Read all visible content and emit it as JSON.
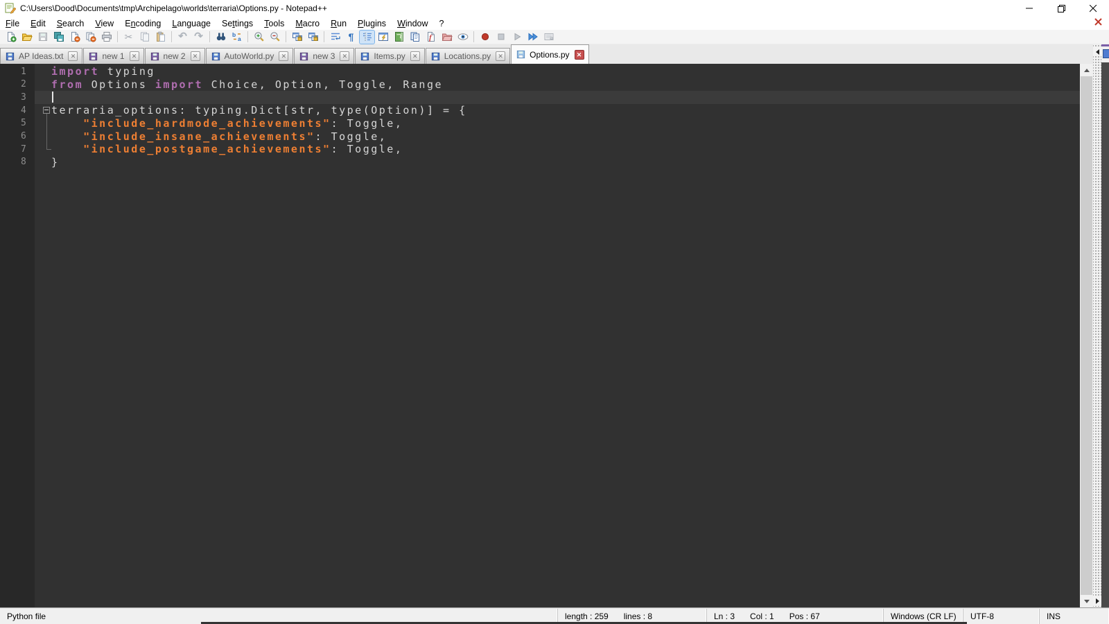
{
  "window": {
    "title": "C:\\Users\\Dood\\Documents\\tmp\\Archipelago\\worlds\\terraria\\Options.py - Notepad++"
  },
  "menu": {
    "items": [
      {
        "label": "File",
        "accel": 0
      },
      {
        "label": "Edit",
        "accel": 0
      },
      {
        "label": "Search",
        "accel": 0
      },
      {
        "label": "View",
        "accel": 0
      },
      {
        "label": "Encoding",
        "accel": 1
      },
      {
        "label": "Language",
        "accel": 0
      },
      {
        "label": "Settings",
        "accel": 2
      },
      {
        "label": "Tools",
        "accel": 0
      },
      {
        "label": "Macro",
        "accel": 0
      },
      {
        "label": "Run",
        "accel": 0
      },
      {
        "label": "Plugins",
        "accel": 0
      },
      {
        "label": "Window",
        "accel": 0
      },
      {
        "label": "?",
        "accel": -1
      }
    ]
  },
  "toolbar": {
    "buttons": [
      {
        "name": "new-file",
        "icon": "page-new"
      },
      {
        "name": "open-file",
        "icon": "folder-open"
      },
      {
        "name": "save-file",
        "icon": "floppy-gray",
        "disabled": true
      },
      {
        "name": "save-all",
        "icon": "floppy-all"
      },
      {
        "name": "close-file",
        "icon": "page-close"
      },
      {
        "name": "close-all",
        "icon": "pages-close"
      },
      {
        "name": "print",
        "icon": "printer"
      },
      {
        "sep": true
      },
      {
        "name": "cut",
        "icon": "scissors",
        "disabled": true
      },
      {
        "name": "copy",
        "icon": "copy",
        "disabled": true
      },
      {
        "name": "paste",
        "icon": "paste",
        "disabled": true
      },
      {
        "sep": true
      },
      {
        "name": "undo",
        "icon": "undo",
        "disabled": true
      },
      {
        "name": "redo",
        "icon": "redo",
        "disabled": true
      },
      {
        "sep": true
      },
      {
        "name": "find",
        "icon": "binoculars"
      },
      {
        "name": "replace",
        "icon": "replace"
      },
      {
        "sep": true
      },
      {
        "name": "zoom-in",
        "icon": "zoom-in"
      },
      {
        "name": "zoom-out",
        "icon": "zoom-out"
      },
      {
        "sep": true
      },
      {
        "name": "sync-vertical-scroll",
        "icon": "sync-v"
      },
      {
        "name": "sync-horizontal-scroll",
        "icon": "sync-h"
      },
      {
        "sep": true
      },
      {
        "name": "word-wrap",
        "icon": "wrap"
      },
      {
        "name": "show-all-characters",
        "icon": "pilcrow"
      },
      {
        "name": "show-indent-guide",
        "icon": "indent-guide",
        "pressed": true
      },
      {
        "name": "user-defined-language",
        "icon": "udl"
      },
      {
        "name": "document-map",
        "icon": "doc-map"
      },
      {
        "name": "document-list",
        "icon": "doc-list"
      },
      {
        "name": "function-list",
        "icon": "func-list"
      },
      {
        "name": "folder-as-workspace",
        "icon": "folder-ws"
      },
      {
        "name": "monitoring",
        "icon": "eye"
      },
      {
        "sep": true
      },
      {
        "name": "macro-record",
        "icon": "record"
      },
      {
        "name": "macro-stop",
        "icon": "stop",
        "disabled": true
      },
      {
        "name": "macro-play",
        "icon": "play",
        "disabled": true
      },
      {
        "name": "macro-run-multiple",
        "icon": "play-multi"
      },
      {
        "name": "macro-save",
        "icon": "macro-save",
        "disabled": true
      }
    ]
  },
  "tabs": [
    {
      "label": "AP Ideas.txt",
      "state": "saved"
    },
    {
      "label": "new 1",
      "state": "modified"
    },
    {
      "label": "new 2",
      "state": "modified"
    },
    {
      "label": "AutoWorld.py",
      "state": "saved"
    },
    {
      "label": "new 3",
      "state": "modified"
    },
    {
      "label": "Items.py",
      "state": "saved"
    },
    {
      "label": "Locations.py",
      "state": "saved"
    },
    {
      "label": "Options.py",
      "state": "active"
    }
  ],
  "editor": {
    "lines": [
      {
        "num": "1",
        "segs": [
          {
            "t": "k",
            "x": "import"
          },
          {
            "t": "d",
            "x": " typing"
          }
        ]
      },
      {
        "num": "2",
        "segs": [
          {
            "t": "k",
            "x": "from"
          },
          {
            "t": "d",
            "x": " Options "
          },
          {
            "t": "k",
            "x": "import"
          },
          {
            "t": "d",
            "x": " Choice, Option, Toggle, Range"
          }
        ]
      },
      {
        "num": "3",
        "segs": [],
        "current": true,
        "caret": true
      },
      {
        "num": "4",
        "segs": [
          {
            "t": "d",
            "x": "terraria_options: typing.Dict[str, type(Option)] = {"
          }
        ],
        "fold": "box"
      },
      {
        "num": "5",
        "segs": [
          {
            "t": "d",
            "x": "    "
          },
          {
            "t": "s",
            "x": "\"include_hardmode_achievements\""
          },
          {
            "t": "d",
            "x": ": Toggle,"
          }
        ],
        "fold": "line"
      },
      {
        "num": "6",
        "segs": [
          {
            "t": "d",
            "x": "    "
          },
          {
            "t": "s",
            "x": "\"include_insane_achievements\""
          },
          {
            "t": "d",
            "x": ": Toggle,"
          }
        ],
        "fold": "line"
      },
      {
        "num": "7",
        "segs": [
          {
            "t": "d",
            "x": "    "
          },
          {
            "t": "s",
            "x": "\"include_postgame_achievements\""
          },
          {
            "t": "d",
            "x": ": Toggle,"
          }
        ],
        "fold": "corner"
      },
      {
        "num": "8",
        "segs": [
          {
            "t": "d",
            "x": "}"
          }
        ]
      }
    ]
  },
  "status": {
    "doc_type": "Python file",
    "length": "length : 259",
    "lines": "lines : 8",
    "ln": "Ln : 3",
    "col": "Col : 1",
    "pos": "Pos : 67",
    "eol": "Windows (CR LF)",
    "encoding": "UTF-8",
    "insert_mode": "INS"
  },
  "colors": {
    "keyword": "#b06eb0",
    "string": "#ee7f33",
    "text": "#d6d6d6",
    "editor_bg": "#313131",
    "gutter_bg": "#282828",
    "line_number": "#8d8d8d",
    "current_line_bg": "#3b3b3b",
    "active_tab_close": "#c75050"
  }
}
